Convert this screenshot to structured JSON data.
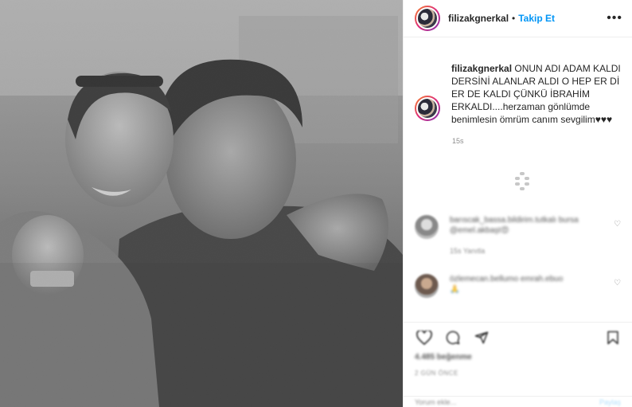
{
  "post": {
    "username": "filizakgnerkal",
    "separator": "•",
    "follow_label": "Takip Et",
    "more_icon": "more-horizontal-icon",
    "caption_username": "filizakgnerkal",
    "caption_body": "ONUN ADI ADAM KALDI DERSİNİ ALANLAR ALDI O HEP ER Dİ ER DE KALDI ÇÜNKÜ İBRAHİM ERKALDI....herzaman gönlümde benimlesin ömrüm canım sevgilim♥♥♥",
    "timestamp": "15s"
  },
  "comments": [
    {
      "line1": "barıscak_bassa.bildirim.tutkalı bursa",
      "line2": "@emel.akbaşt😍",
      "meta": "15s   Yanıtla"
    },
    {
      "line1": "özlemecan.bellumo emrah.ebuo",
      "line2": "🙏",
      "meta": ""
    }
  ],
  "actions": {
    "icons": [
      "heart-icon",
      "comment-icon",
      "share-icon",
      "bookmark-icon"
    ],
    "likes": "4.485 beğenme",
    "date": "2 GÜN ÖNCE"
  },
  "add_comment": {
    "placeholder": "Yorum ekle...",
    "post_label": "Paylaş"
  },
  "colors": {
    "accent": "#0095f6",
    "text": "#262626",
    "muted": "#8e8e8e",
    "border": "#efefef"
  }
}
